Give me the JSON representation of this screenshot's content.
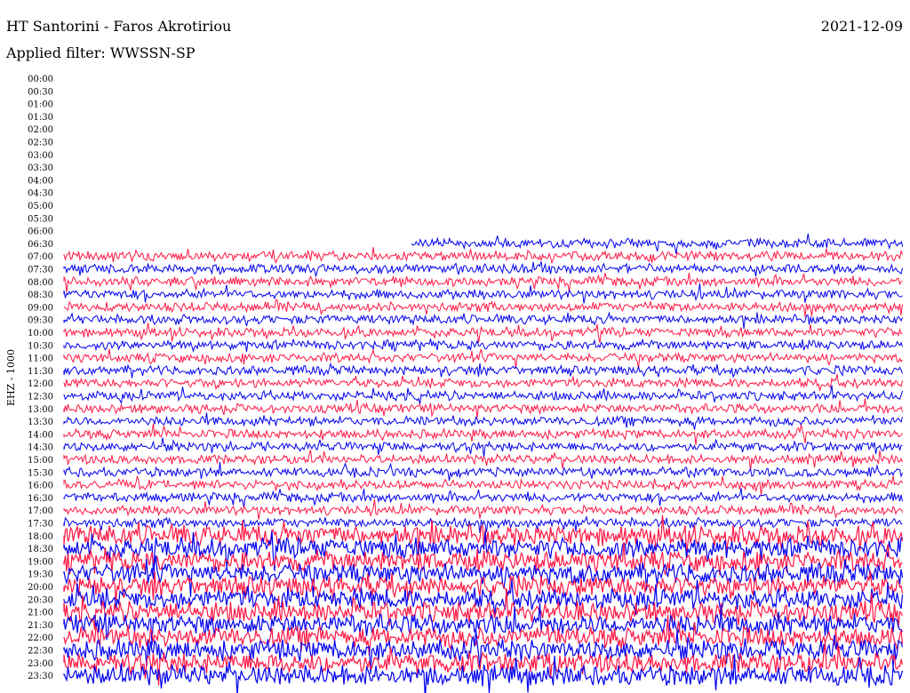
{
  "header": {
    "station": "HT Santorini - Faros Akrotiriou",
    "date": "2021-12-09",
    "filter": "Applied filter: WWSSN-SP"
  },
  "chart_data": {
    "type": "helicorder",
    "channel_label": "EHZ - 1000",
    "colors": {
      "trace_a": "#0000ee",
      "trace_b": "#ff1744"
    },
    "y_tick_labels": [
      "00:00",
      "00:30",
      "01:00",
      "01:30",
      "02:00",
      "02:30",
      "03:00",
      "03:30",
      "04:00",
      "04:30",
      "05:00",
      "05:30",
      "06:00",
      "06:30",
      "07:00",
      "07:30",
      "08:00",
      "08:30",
      "09:00",
      "09:30",
      "10:00",
      "10:30",
      "11:00",
      "11:30",
      "12:00",
      "12:30",
      "13:00",
      "13:30",
      "14:00",
      "14:30",
      "15:00",
      "15:30",
      "16:00",
      "16:30",
      "17:00",
      "17:30",
      "18:00",
      "18:30",
      "19:00",
      "19:30",
      "20:00",
      "20:30",
      "21:00",
      "21:30",
      "22:00",
      "22:30",
      "23:00",
      "23:30"
    ],
    "data_start_row": "06:30",
    "rows": {
      "06:30": {
        "start_fraction": 0.415,
        "level": 3
      },
      "07:00": {
        "start_fraction": 0.0,
        "level": 3
      },
      "07:30": {
        "level": 3
      },
      "08:00": {
        "level": 3
      },
      "08:30": {
        "level": 3
      },
      "09:00": {
        "level": 3
      },
      "09:30": {
        "level": 3
      },
      "10:00": {
        "level": 3
      },
      "10:30": {
        "level": 3
      },
      "11:00": {
        "level": 3
      },
      "11:30": {
        "level": 3
      },
      "12:00": {
        "level": 3
      },
      "12:30": {
        "level": 3
      },
      "13:00": {
        "level": 3
      },
      "13:30": {
        "level": 3
      },
      "14:00": {
        "level": 3
      },
      "14:30": {
        "level": 3
      },
      "15:00": {
        "level": 3
      },
      "15:30": {
        "level": 3
      },
      "16:00": {
        "level": 3
      },
      "16:30": {
        "level": 3
      },
      "17:00": {
        "level": 3
      },
      "17:30": {
        "level": 3
      },
      "18:00": {
        "level": 5
      },
      "18:30": {
        "level": 5
      },
      "19:00": {
        "level": 5
      },
      "19:30": {
        "level": 5
      },
      "20:00": {
        "level": 5
      },
      "20:30": {
        "level": 5
      },
      "21:00": {
        "level": 5
      },
      "21:30": {
        "level": 5
      },
      "22:00": {
        "level": 5
      },
      "22:30": {
        "level": 5
      },
      "23:00": {
        "level": 5
      },
      "23:30": {
        "level": 5
      }
    }
  }
}
